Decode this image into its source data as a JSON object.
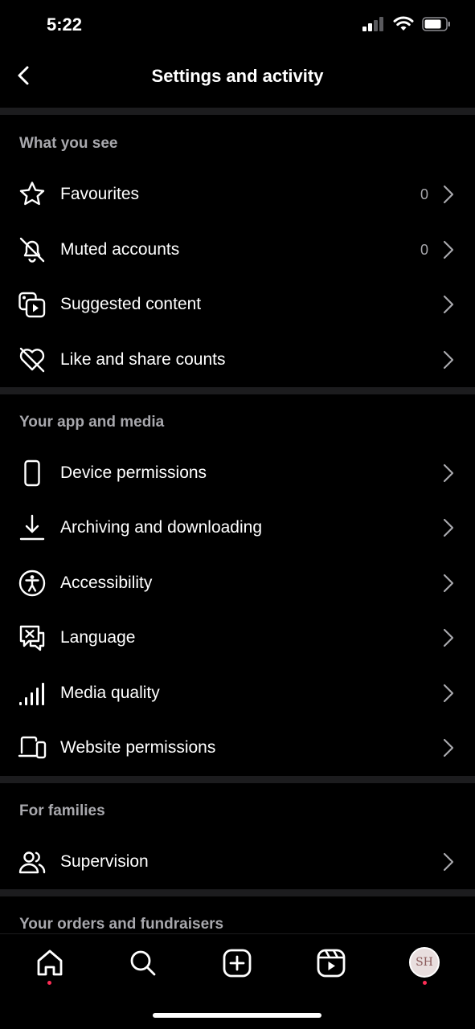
{
  "status_bar": {
    "time": "5:22"
  },
  "header": {
    "title": "Settings and activity"
  },
  "sections": [
    {
      "title": "What you see",
      "items": [
        {
          "label": "Favourites",
          "count": "0",
          "icon": "star-icon"
        },
        {
          "label": "Muted accounts",
          "count": "0",
          "icon": "muted-bell-icon"
        },
        {
          "label": "Suggested content",
          "icon": "suggested-content-icon"
        },
        {
          "label": "Like and share counts",
          "icon": "heart-off-icon"
        }
      ]
    },
    {
      "title": "Your app and media",
      "items": [
        {
          "label": "Device permissions",
          "icon": "phone-icon"
        },
        {
          "label": "Archiving and downloading",
          "icon": "download-icon"
        },
        {
          "label": "Accessibility",
          "icon": "accessibility-icon"
        },
        {
          "label": "Language",
          "icon": "language-icon"
        },
        {
          "label": "Media quality",
          "icon": "signal-bars-icon"
        },
        {
          "label": "Website permissions",
          "icon": "laptop-phone-icon"
        }
      ]
    },
    {
      "title": "For families",
      "items": [
        {
          "label": "Supervision",
          "icon": "people-icon"
        }
      ]
    },
    {
      "title": "Your orders and fundraisers",
      "items": []
    }
  ],
  "tabbar": {
    "tabs": [
      "home-icon",
      "search-icon",
      "create-icon",
      "reels-icon",
      "profile-avatar"
    ],
    "avatar_initials": "SH"
  },
  "colors": {
    "background": "#000000",
    "divider": "#1c1c1e",
    "muted_text": "#a8a8ad",
    "notification_dot": "#ff2d55"
  }
}
